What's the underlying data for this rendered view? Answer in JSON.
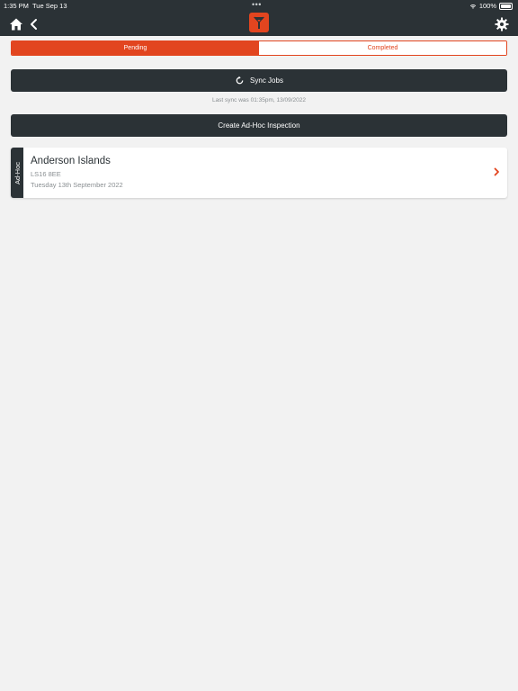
{
  "status_bar": {
    "time": "1:35 PM",
    "date": "Tue Sep 13",
    "dots": "•••",
    "battery": "100%"
  },
  "nav": {
    "home_icon": "home-icon",
    "back_icon": "chevron-left-icon",
    "logo_icon": "brand-logo",
    "settings_icon": "gear-icon"
  },
  "tabs": [
    {
      "label": "Pending",
      "active": true
    },
    {
      "label": "Completed",
      "active": false
    }
  ],
  "sync": {
    "label": "Sync Jobs",
    "icon": "refresh-icon",
    "last_sync": "Last sync was 01:35pm, 13/09/2022"
  },
  "create": {
    "label": "Create Ad-Hoc Inspection"
  },
  "jobs": [
    {
      "type": "Ad-Hoc",
      "title": "Anderson Islands",
      "postcode": "LS16 8EE",
      "date": "Tuesday 13th September 2022"
    }
  ],
  "colors": {
    "accent": "#e2451f",
    "dark": "#2b3236",
    "background": "#f2f2f2"
  }
}
